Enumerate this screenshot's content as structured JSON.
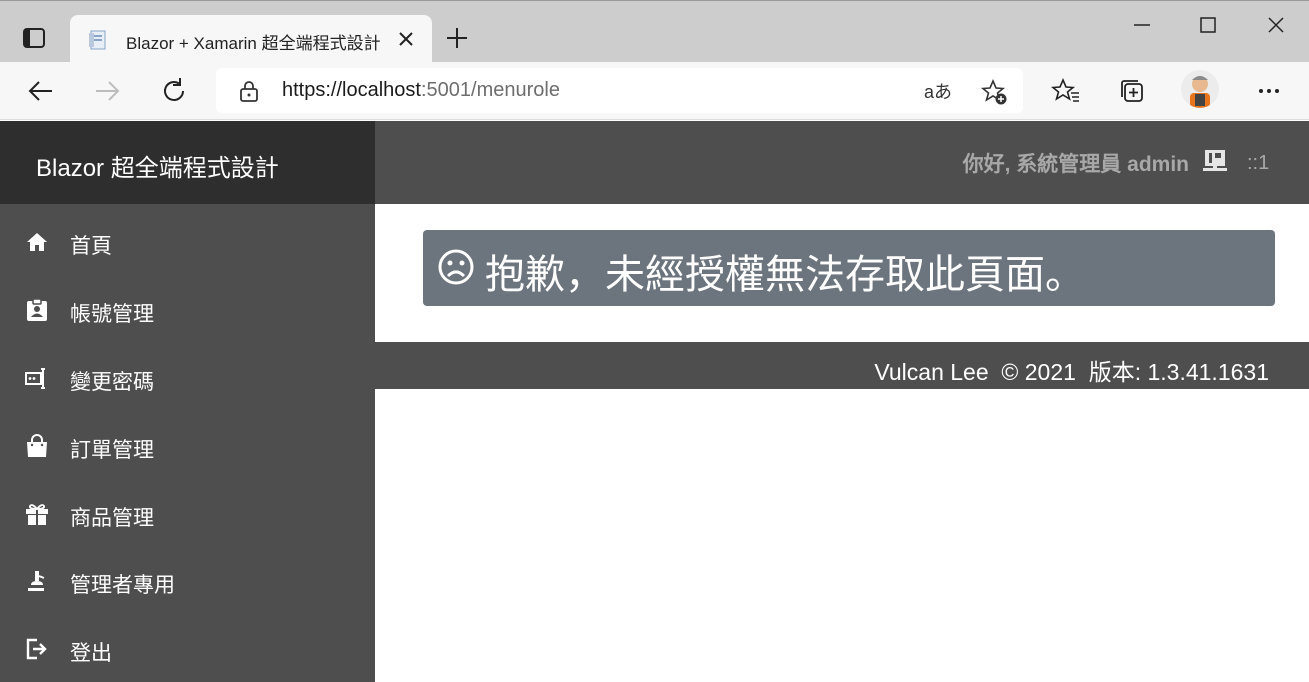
{
  "browser": {
    "tab_title": "Blazor + Xamarin 超全端程式設計",
    "url_host": "https://localhost",
    "url_rest": ":5001/menurole",
    "read_aloud": "aあ"
  },
  "app": {
    "brand": "Blazor 超全端程式設計",
    "greeting": "你好, 系統管理員 admin",
    "connection_count": "::1",
    "nav": [
      {
        "label": "首頁",
        "icon": "home-icon"
      },
      {
        "label": "帳號管理",
        "icon": "id-badge-icon"
      },
      {
        "label": "變更密碼",
        "icon": "password-icon"
      },
      {
        "label": "訂單管理",
        "icon": "shopping-bag-icon"
      },
      {
        "label": "商品管理",
        "icon": "gift-icon"
      },
      {
        "label": "管理者專用",
        "icon": "lab-icon"
      },
      {
        "label": "登出",
        "icon": "logout-icon"
      }
    ],
    "alert_text": "抱歉，未經授權無法存取此頁面。",
    "footer": "Vulcan Lee  © 2021  版本: 1.3.41.1631"
  },
  "colors": {
    "sidebar": "#4e4e4e",
    "brand_bar": "#2e2e2e",
    "alert": "#6c757d"
  }
}
